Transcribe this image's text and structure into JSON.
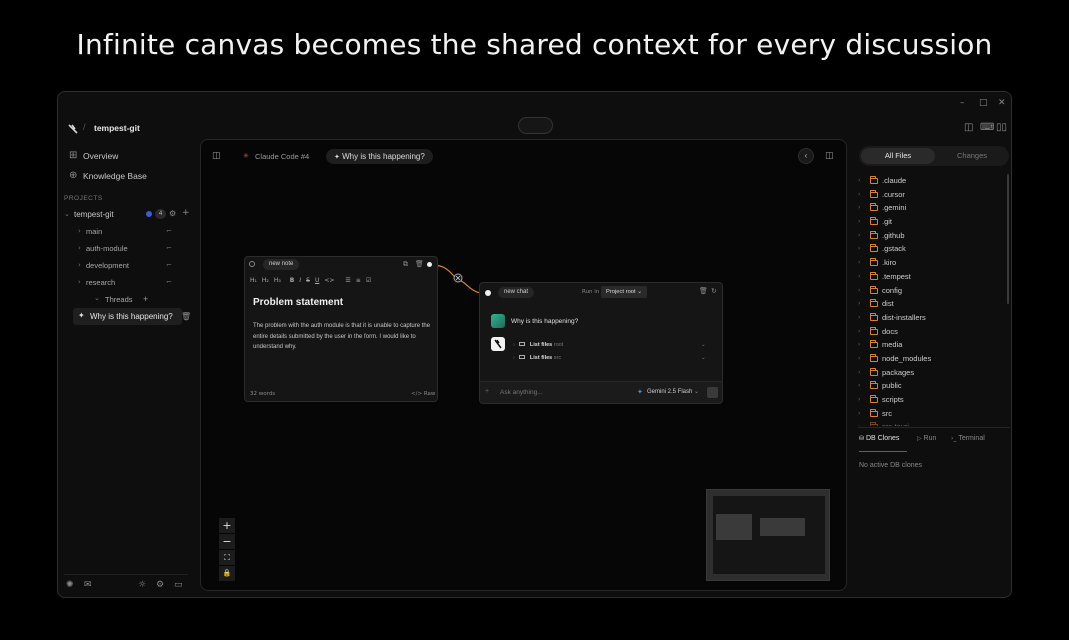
{
  "headline": "Infinite canvas becomes the shared context for every discussion",
  "window_controls": {
    "minimize": "–",
    "maximize": "□",
    "close": "✕"
  },
  "header": {
    "separator": "/",
    "repo_name": "tempest-git"
  },
  "sidebar": {
    "overview": "Overview",
    "knowledge_base": "Knowledge Base",
    "projects_label": "PROJECTS",
    "project": {
      "name": "tempest-git",
      "badge": "4"
    },
    "branches": [
      "main",
      "auth-module",
      "development",
      "research"
    ],
    "threads_label": "Threads",
    "thread_add": "+",
    "thread_item": "Why is this happening?"
  },
  "tabs": [
    {
      "label": "Claude Code #4"
    },
    {
      "label": "Why is this happening?"
    }
  ],
  "note_card": {
    "tag": "new note",
    "toolbar": [
      "H₁",
      "H₂",
      "H₃",
      "B",
      "I",
      "S",
      "U",
      "<>"
    ],
    "title": "Problem statement",
    "body": "The problem with the auth module is that it is unable to capture the entire details submitted by the user in the form. I would like to understand why.",
    "word_count": "32 words",
    "raw_label": "</> Raw"
  },
  "chat_card": {
    "tag": "new chat",
    "run_in_label": "Run in",
    "run_in_value": "Project root",
    "user_message": "Why is this happening?",
    "tool_calls": [
      {
        "label": "List files",
        "arg": "root"
      },
      {
        "label": "List files",
        "arg": "src"
      }
    ],
    "input_placeholder": "Ask anything...",
    "model": "Gemini 2.5 Flash"
  },
  "zoom_controls": {
    "plus": "+",
    "minus": "−",
    "fit": "⛶",
    "lock": "🔒"
  },
  "right_panel": {
    "tabs": [
      "All Files",
      "Changes"
    ],
    "files": [
      ".claude",
      ".cursor",
      ".gemini",
      ".git",
      ".github",
      ".gstack",
      ".kiro",
      ".tempest",
      "config",
      "dist",
      "dist-installers",
      "docs",
      "media",
      "node_modules",
      "packages",
      "public",
      "scripts",
      "src",
      "src-tauri"
    ],
    "bottom_tabs": [
      "DB Clones",
      "Run",
      "Terminal"
    ],
    "empty_message": "No active DB clones"
  },
  "colors": {
    "accent_orange": "#d9822b",
    "badge_blue": "#3b5bdb",
    "background": "#0e0e0e",
    "canvas": "#060606"
  }
}
